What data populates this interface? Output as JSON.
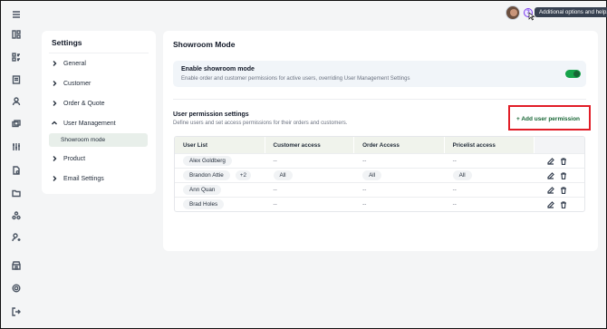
{
  "topbar": {
    "tooltip": "Additional options and help."
  },
  "settings_nav": {
    "title": "Settings",
    "items": [
      {
        "label": "General",
        "expanded": false
      },
      {
        "label": "Customer",
        "expanded": false
      },
      {
        "label": "Order & Quote",
        "expanded": false
      },
      {
        "label": "User Management",
        "expanded": true
      },
      {
        "label": "Product",
        "expanded": false
      },
      {
        "label": "Email Settings",
        "expanded": false
      }
    ],
    "sub_item": "Showroom mode"
  },
  "main": {
    "title": "Showroom Mode",
    "enable": {
      "title": "Enable showroom mode",
      "description": "Enable order and customer permissions for active users, overriding User Management Settings",
      "enabled": true
    },
    "permissions": {
      "title": "User permission settings",
      "description": "Define users and set access permissions for their orders and customers.",
      "add_button": "+ Add user permission"
    },
    "table": {
      "headers": [
        "User List",
        "Customer access",
        "Order Access",
        "Pricelist access"
      ],
      "rows": [
        {
          "user": "Alex Goldberg",
          "extra": "",
          "customer": "--",
          "order": "--",
          "pricelist": "--"
        },
        {
          "user": "Brandon Attie",
          "extra": "+2",
          "customer": "All",
          "order": "All",
          "pricelist": "All"
        },
        {
          "user": "Ann Quan",
          "extra": "",
          "customer": "--",
          "order": "--",
          "pricelist": "--"
        },
        {
          "user": "Brad Holes",
          "extra": "",
          "customer": "--",
          "order": "--",
          "pricelist": "--"
        }
      ]
    }
  },
  "colors": {
    "accent": "#166534",
    "toggle_on": "#16a34a",
    "highlight": "#e11d27"
  }
}
